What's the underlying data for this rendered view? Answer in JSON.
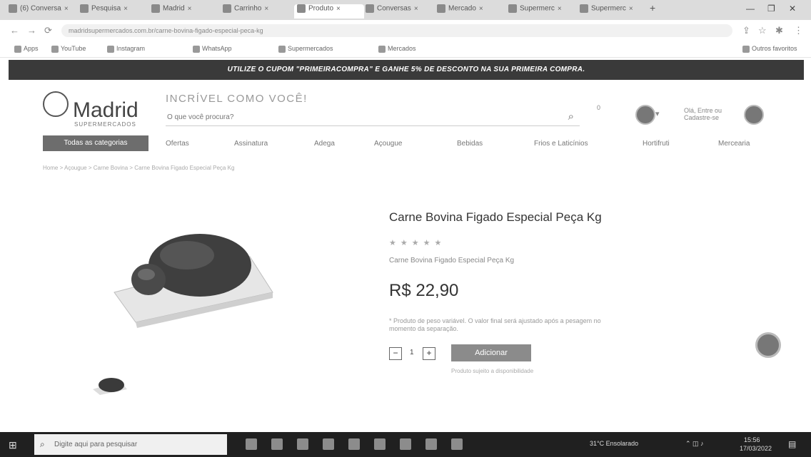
{
  "browser": {
    "tabs": [
      "(6) Conversa",
      "Pesquisa",
      "Madrid",
      "Carrinho",
      "Produto",
      "Conversas",
      "Mercado",
      "Supermerc",
      "Supermerc"
    ],
    "url": "madridsupermercados.com.br/carne-bovina-figado-especial-peca-kg",
    "bookmarks": [
      "Apps",
      "YouTube",
      "Instagram",
      "WhatsApp",
      "Supermercados",
      "Mercados",
      "Outros favoritos"
    ]
  },
  "promo": "UTILIZE O CUPOM \"PRIMEIRACOMPRA\" E GANHE 5% DE DESCONTO NA SUA PRIMEIRA COMPRA.",
  "header": {
    "logo_name": "Madrid",
    "logo_sub": "SUPERMERCADOS",
    "slogan": "INCRÍVEL COMO VOCÊ!",
    "search_placeholder": "O que você procura?",
    "cart_count": "0",
    "login_text": "Olá, Entre ou Cadastre-se"
  },
  "nav": {
    "all_categories": "Todas as categorias",
    "items": [
      "Ofertas",
      "Assinatura",
      "Adega",
      "Açougue",
      "Bebidas",
      "Frios e Laticínios",
      "Hortifruti",
      "Mercearia"
    ]
  },
  "breadcrumb": "Home > Açougue > Carne Bovina > Carne Bovina Figado Especial Peça Kg",
  "product": {
    "title": "Carne Bovina Figado Especial Peça Kg",
    "stars": "★★★★★",
    "description": "Carne Bovina Figado Especial Peça Kg",
    "price": "R$ 22,90",
    "note": "* Produto de peso variável. O valor final será ajustado após a pesagem no momento da separação.",
    "qty_minus": "−",
    "qty_value": "1",
    "qty_plus": "+",
    "add_button": "Adicionar",
    "add_note": "Produto sujeito a disponibilidade"
  },
  "taskbar": {
    "search_placeholder": "Digite aqui para pesquisar",
    "weather": "31°C Ensolarado",
    "time": "15:56",
    "date": "17/03/2022"
  }
}
